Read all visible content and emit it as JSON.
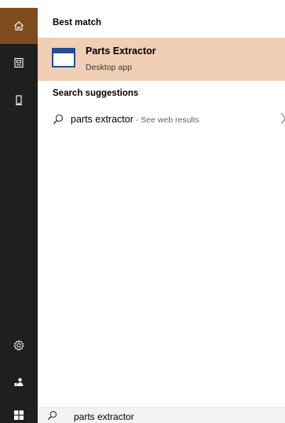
{
  "sections": {
    "best_match": "Best match",
    "search_suggestions": "Search suggestions"
  },
  "best_match_item": {
    "title": "Parts Extractor",
    "subtitle": "Desktop app",
    "icon": "app-window-icon"
  },
  "suggestion": {
    "query": "parts extractor",
    "hint": " - See web results"
  },
  "search_box": {
    "value": "parts extractor"
  },
  "rail_icons": [
    "home-icon",
    "documents-icon",
    "device-icon",
    "settings-icon",
    "people-icon"
  ],
  "colors": {
    "rail_bg": "#1f1f1f",
    "home_active": "#7f4b1f",
    "highlight_row": "#f0cfb4",
    "app_icon_blue": "#1e4f91"
  }
}
